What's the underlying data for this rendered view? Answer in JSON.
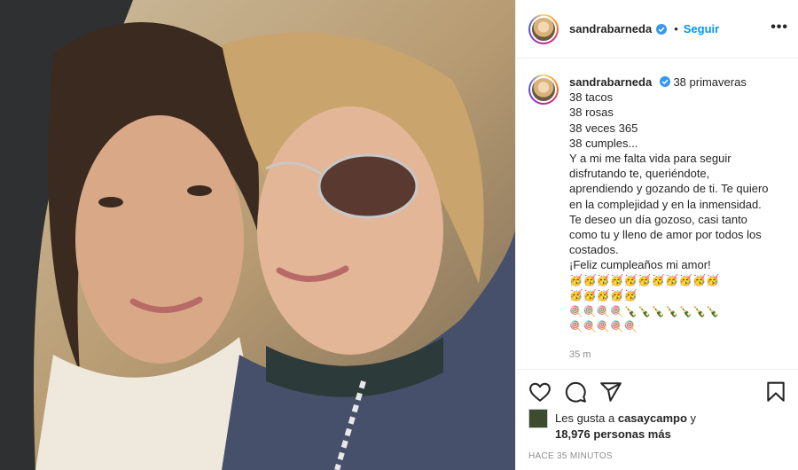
{
  "post": {
    "username": "sandrabarneda",
    "follow_label": "Seguir",
    "dot": "•",
    "more_label": "•••",
    "caption": {
      "lines": [
        "38 primaveras",
        "38 tacos",
        "38 rosas",
        "38 veces 365",
        "38 cumples...",
        "Y a mi me falta vida para seguir",
        "disfrutando te, queriéndote,",
        "aprendiendo y gozando de ti. Te quiero",
        "en la complejidad y en la inmensidad.",
        "Te deseo un día gozoso, casi tanto",
        "como tu y lleno de amor por todos los",
        "costados.",
        "¡Feliz cumpleaños mi amor!"
      ],
      "emoji_rows": [
        "🥳🥳🥳🥳🥳🥳🥳🥳🥳🥳🥳",
        "🥳🥳🥳🥳🥳",
        "🍭🍭🍭🍭🍾🍾🍾🍾🍾🍾🍾",
        "🍭🍭🍭🍭🍭"
      ],
      "time": "35 m"
    },
    "likes": {
      "prefix": "Les gusta a",
      "user": "casaycampo",
      "connector": "y",
      "count": "18,976 personas más"
    },
    "timestamp": "HACE 35 MINUTOS",
    "colors": {
      "link": "#0095f6",
      "verified": "#3897f0",
      "muted": "#8e8e8e"
    },
    "icons": [
      "heart-icon",
      "comment-icon",
      "share-icon",
      "bookmark-icon"
    ]
  }
}
